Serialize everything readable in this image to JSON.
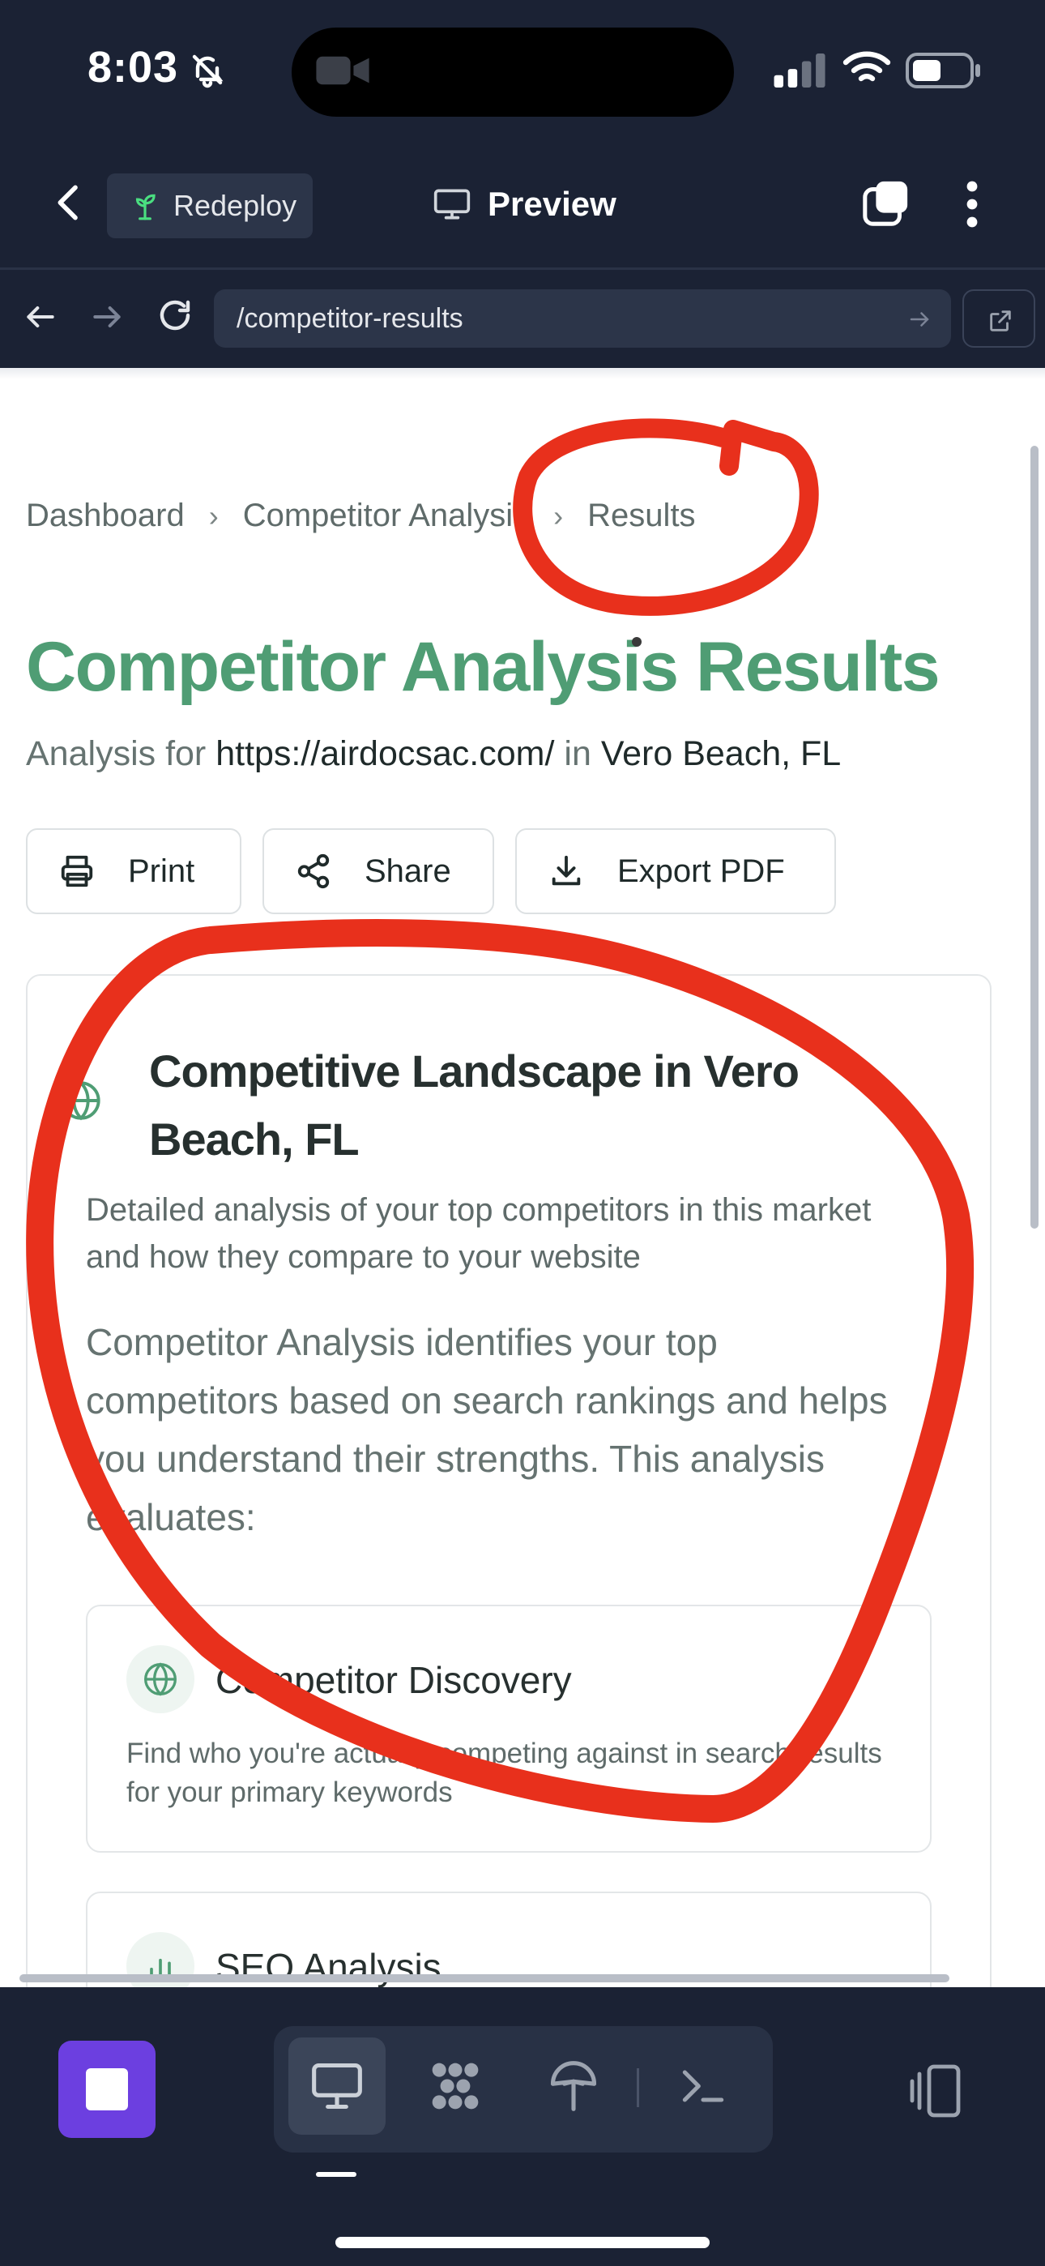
{
  "status_bar": {
    "time": "8:03"
  },
  "header": {
    "redeploy_label": "Redeploy",
    "preview_label": "Preview"
  },
  "url_bar": {
    "url": "/competitor-results"
  },
  "breadcrumb": {
    "items": [
      "Dashboard",
      "Competitor Analysis",
      "Results"
    ],
    "separator": "›"
  },
  "page": {
    "title": "Competitor Analysis Results",
    "subtitle_prefix": "Analysis for ",
    "subtitle_url": "https://airdocsac.com/",
    "subtitle_in": " in ",
    "subtitle_location": "Vero Beach, FL"
  },
  "actions": {
    "print": "Print",
    "share": "Share",
    "export": "Export PDF"
  },
  "card": {
    "title": "Competitive Landscape in Vero Beach, FL",
    "description": "Detailed analysis of your top competitors in this market and how they compare to your website",
    "body": "Competitor Analysis identifies your top competitors based on search rankings and helps you understand their strengths. This analysis evaluates:",
    "features": [
      {
        "title": "Competitor Discovery",
        "description": "Find who you're actually competing against in search results for your primary keywords"
      },
      {
        "title": "SEO Analysis",
        "description": ""
      }
    ]
  },
  "colors": {
    "accent": "#4f9d74",
    "annotation": "#e8301c",
    "app_bg": "#1b2234",
    "stop_button": "#6c3fe0"
  },
  "icons": [
    "bell-slash-icon",
    "video-icon",
    "signal-icon",
    "wifi-icon",
    "battery-icon",
    "chevron-left-icon",
    "sprout-icon",
    "monitor-icon",
    "tabs-icon",
    "more-vertical-icon",
    "arrow-left-icon",
    "arrow-right-icon",
    "reload-icon",
    "external-link-icon",
    "printer-icon",
    "share-icon",
    "download-icon",
    "globe-icon",
    "bar-chart-icon",
    "stop-icon",
    "desktop-icon",
    "grid-icon",
    "deploy-icon",
    "terminal-icon",
    "device-toggle-icon"
  ]
}
